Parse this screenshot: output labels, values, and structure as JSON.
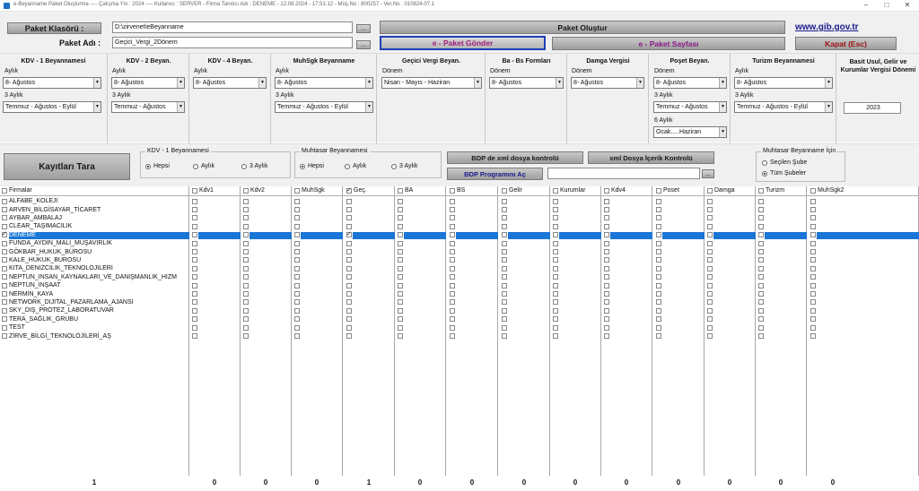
{
  "window": {
    "title": "e-Beyanname Paket Oluşturma  ----  Çalışma Yılı : 2024  ----  Kullanıcı : SERVER - Firma Tanıtıcı Adı : DENEME - 12.08.2024 - 17:51:12 - Müş.No : 800257 - Ver.No : 010824-07.1"
  },
  "top": {
    "paket_klasoru_label": "Paket Klasörü :",
    "paket_klasoru_value": "D:\\zirvenet\\eBeyanname",
    "paket_adi_label": "Paket Adı :",
    "paket_adi_value": "Geçici_Vergi_2Dönem",
    "browse_label": "...",
    "paket_olustur": "Paket Oluştur",
    "e_paket_gonder": "e - Paket Gönder",
    "e_paket_sayfasi": "e - Paket Sayfası",
    "gib_link": "www.gib.gov.tr",
    "kapat": "Kapat (Esc)"
  },
  "config": {
    "kdv1": {
      "title": "KDV - 1 Beyannamesi",
      "l1": "Aylık",
      "v1": "8- Ağustos",
      "l2": "3 Aylık",
      "v2": "Temmuz - Ağustos - Eylül"
    },
    "kdv2": {
      "title": "KDV - 2 Beyan.",
      "l1": "Aylık",
      "v1": "8- Ağustos",
      "l2": "3 Aylık",
      "v2": "Temmuz - Ağustos"
    },
    "kdv4": {
      "title": "KDV - 4 Beyan.",
      "l1": "Aylık",
      "v1": "8- Ağustos"
    },
    "muhsgk": {
      "title": "MuhSgk Beyanname",
      "l1": "Aylık",
      "v1": "8- Ağustos",
      "l2": "3 Aylık",
      "v2": "Temmuz - Ağustos - Eylül"
    },
    "gecici": {
      "title": "Geçici Vergi Beyan.",
      "l1": "Dönem",
      "v1": "Nisan - Mayıs - Haziran"
    },
    "babs": {
      "title": "Ba - Bs Formları",
      "l1": "Dönem",
      "v1": "8- Ağustos"
    },
    "damga": {
      "title": "Damga Vergisi",
      "l1": "Dönem",
      "v1": "8- Ağustos"
    },
    "poset": {
      "title": "Poşet Beyan.",
      "l1": "Dönem",
      "v1": "8- Ağustos",
      "l2": "3 Aylık",
      "v2": "Temmuz - Ağustos",
      "l3": "6 Aylık",
      "v3": "Ocak.....Haziran"
    },
    "turizm": {
      "title": "Turizm Beyannamesi",
      "l1": "Aylık",
      "v1": "8- Ağustos",
      "l2": "3 Aylık",
      "v2": "Temmuz - Ağustos - Eylül"
    },
    "basit": {
      "title": "Basit Usul, Gelir ve Kurumlar Vergisi Dönemi",
      "value": "2023"
    }
  },
  "controls": {
    "kayitlari_tara": "Kayıtları Tara",
    "kdv1_group": "KDV - 1 Beyannamesi",
    "muhtasar_group": "Muhtasar Beyannamesi",
    "hepsi": "Hepsi",
    "aylik": "Aylık",
    "uc_aylik": "3 Aylık",
    "bdp_xml": "BDP de xml dosya kontrolü",
    "xml_icerik": "xml Dosya İçerik Kontrolü",
    "bdp_ac": "BDP Programını Aç",
    "browse": "...",
    "muhtasar_icin": "Muhtasar Beyanname İçin",
    "secilen_sube": "Seçilen Şube",
    "tum_subeler": "Tüm Şubeler"
  },
  "grid": {
    "firmalar_header": "Firmalar",
    "columns": [
      "Kdv1",
      "Kdv2",
      "MuhSgk",
      "Geç.",
      "BA",
      "BS",
      "Gelir",
      "Kurumlar",
      "Kdv4",
      "Poset",
      "Damga",
      "Turizm",
      "MuhSgk2"
    ],
    "firms": [
      "ALFABE_KOLEJİ",
      "ARVEN_BİLGİSAYAR_TİCARET",
      "AYBAR_AMBALAJ",
      "CLEAR_TAŞIMACILIK",
      "DENEME",
      "FUNDA_AYDIN_MALİ_MÜŞAVİRLİK",
      "GÖKBAR_HUKUK_BÜROSU",
      "KALE_HUKUK_BÜROSU",
      "KITA_DENİZCİLİK_TEKNOLOJİLERİ",
      "NEPTÜN_İNSAN_KAYNAKLARI_VE_DANIŞMANLIK_HİZM",
      "NEPTÜN_İNŞAAT",
      "NERMİN_KAYA",
      "NETWORK_DİJİTAL_PAZARLAMA_AJANSI",
      "SKY_DİŞ_PROTEZ_LABORATUVAR",
      "TERA_SAĞLIK_GRUBU",
      "TEST",
      "ZİRVE_BİLGİ_TEKNOLOJİLERİ_AŞ"
    ],
    "selected_firm": "DENEME",
    "totals": {
      "firms": "1",
      "cols": [
        "0",
        "0",
        "0",
        "1",
        "0",
        "0",
        "0",
        "0",
        "0",
        "0",
        "0",
        "0",
        "0"
      ]
    }
  }
}
